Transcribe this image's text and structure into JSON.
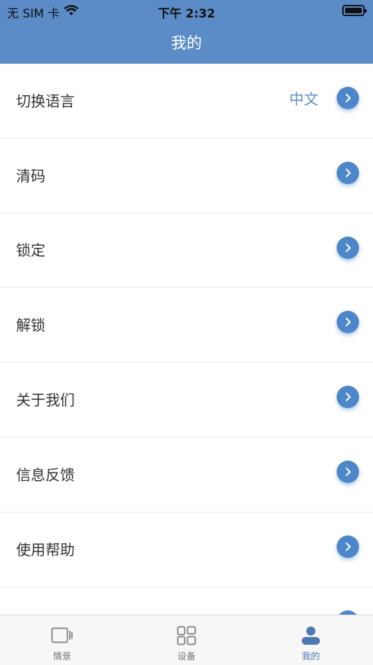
{
  "status_bar": {
    "carrier": "无 SIM 卡",
    "time": "下午 2:32"
  },
  "header": {
    "title": "我的"
  },
  "menu": {
    "items": [
      {
        "label": "切换语言",
        "value": "中文"
      },
      {
        "label": "清码"
      },
      {
        "label": "锁定"
      },
      {
        "label": "解锁"
      },
      {
        "label": "关于我们"
      },
      {
        "label": "信息反馈"
      },
      {
        "label": "使用帮助"
      },
      {
        "label": ""
      }
    ]
  },
  "tabbar": {
    "tabs": [
      {
        "label": "情景",
        "icon": "scene-icon",
        "active": false
      },
      {
        "label": "设备",
        "icon": "device-grid-icon",
        "active": false
      },
      {
        "label": "我的",
        "icon": "user-icon",
        "active": true
      }
    ]
  },
  "colors": {
    "header": "#5b8cc8",
    "accent": "#4d87c9",
    "active_tab": "#4d78b4"
  }
}
